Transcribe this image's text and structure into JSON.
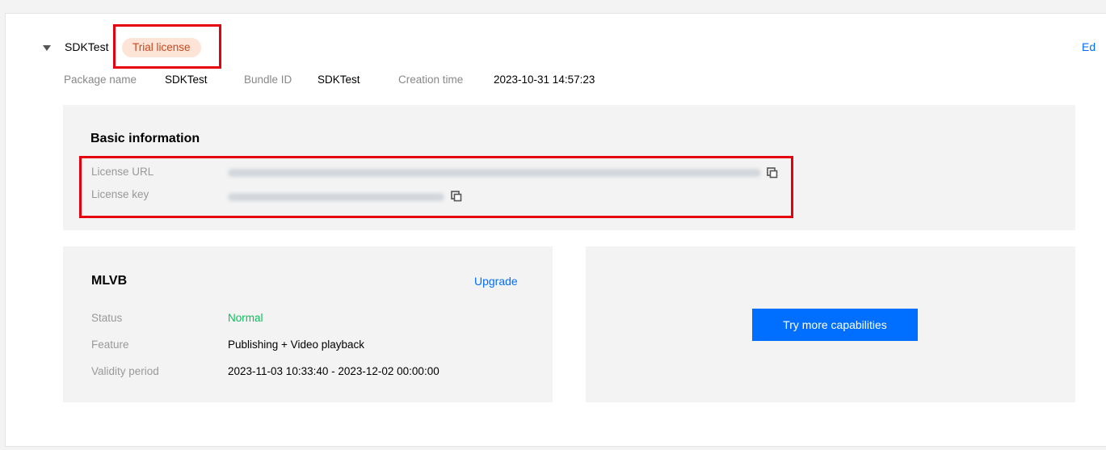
{
  "app": {
    "name": "SDKTest",
    "license_badge": "Trial license",
    "edit_label": "Ed"
  },
  "meta": {
    "package_label": "Package name",
    "package_value": "SDKTest",
    "bundle_label": "Bundle ID",
    "bundle_value": "SDKTest",
    "creation_label": "Creation time",
    "creation_value": "2023-10-31 14:57:23"
  },
  "basic": {
    "title": "Basic information",
    "license_url_label": "License URL",
    "license_key_label": "License key"
  },
  "mlvb": {
    "title": "MLVB",
    "upgrade_label": "Upgrade",
    "status_label": "Status",
    "status_value": "Normal",
    "feature_label": "Feature",
    "feature_value": "Publishing + Video playback",
    "validity_label": "Validity period",
    "validity_value": "2023-11-03 10:33:40 - 2023-12-02 00:00:00"
  },
  "more": {
    "button_label": "Try more capabilities"
  },
  "icons": {
    "caret": "caret-down-icon",
    "copy": "copy-icon"
  },
  "colors": {
    "accent": "#006eff",
    "badge_bg": "#fde4d6",
    "badge_text": "#c5471f",
    "highlight_box": "#e5000f",
    "status_normal": "#0abf5b"
  }
}
